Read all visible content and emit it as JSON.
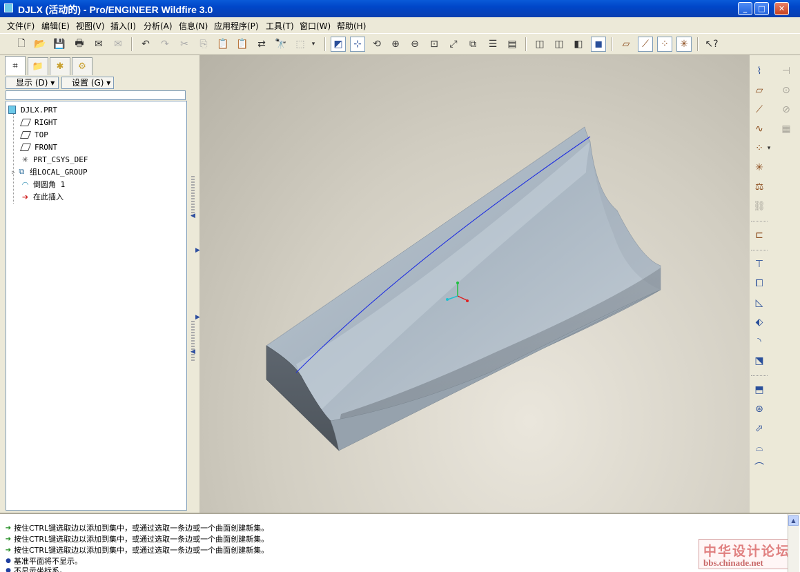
{
  "window": {
    "title": "DJLX (活动的) - Pro/ENGINEER Wildfire 3.0",
    "controls": {
      "minimize": "_",
      "maximize": "□",
      "close": "✕"
    }
  },
  "menu": [
    "文件(F)",
    "编辑(E)",
    "视图(V)",
    "插入(I)",
    "分析(A)",
    "信息(N)",
    "应用程序(P)",
    "工具(T)",
    "窗口(W)",
    "帮助(H)"
  ],
  "navigator": {
    "show_label": "显示 (D) ▾",
    "settings_label": "设置 (G) ▾",
    "tree": [
      {
        "label": "DJLX.PRT",
        "icon": "part-icon"
      },
      {
        "label": "RIGHT",
        "icon": "datum-plane-icon"
      },
      {
        "label": "TOP",
        "icon": "datum-plane-icon"
      },
      {
        "label": "FRONT",
        "icon": "datum-plane-icon"
      },
      {
        "label": "PRT_CSYS_DEF",
        "icon": "csys-icon"
      },
      {
        "label": "组LOCAL_GROUP",
        "icon": "group-icon"
      },
      {
        "label": "倒圆角 1",
        "icon": "round-icon"
      },
      {
        "label": "在此插入",
        "icon": "insert-here-arrow-icon"
      }
    ]
  },
  "messages": [
    "按住CTRL键选取边以添加到集中，或通过选取一条边或一个曲面创建新集。",
    "按住CTRL键选取边以添加到集中，或通过选取一条边或一个曲面创建新集。",
    "按住CTRL键选取边以添加到集中，或通过选取一条边或一个曲面创建新集。",
    "基准平面将不显示。",
    "不显示坐标系。"
  ],
  "watermark": {
    "cn": "中华设计论坛",
    "url": "bbs.chinade.net"
  },
  "colors": {
    "title_bar": "#0046c8",
    "viewport_bg": "#d2cec2",
    "model_face": "#b3c0cc",
    "model_dark": "#5a626b",
    "highlight_edge": "#2030e0"
  }
}
